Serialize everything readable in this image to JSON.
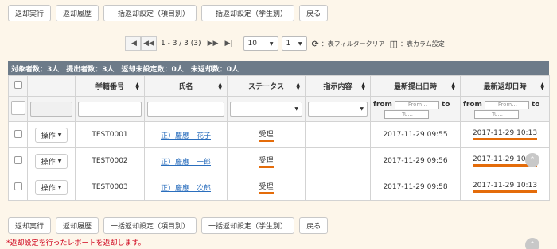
{
  "toolbar": {
    "buttons": [
      "返却実行",
      "返却履歴",
      "一括返却設定（項目別）",
      "一括返却設定（学生別）",
      "戻る"
    ]
  },
  "pager": {
    "range": "1 - 3 / 3 (3)",
    "page_size": "10",
    "page": "1",
    "filter_clear": "：表フィルタークリア",
    "column_settings": "：表カラム設定"
  },
  "summary": "対象者数：3人　提出者数：3人　返却未設定数：0人　未返却数：0人",
  "table": {
    "headers": [
      "学籍番号",
      "氏名",
      "ステータス",
      "指示内容",
      "最新提出日時",
      "最新返却日時"
    ],
    "filter": {
      "from_label": "from",
      "to_label": "to",
      "from_placeholder": "From...",
      "to_placeholder": "To..."
    },
    "op_label": "操作",
    "rows": [
      {
        "id": "TEST0001",
        "name": "正）慶應　花子",
        "status": "受理",
        "submitted": "2017-11-29 09:55",
        "returned": "2017-11-29 10:13"
      },
      {
        "id": "TEST0002",
        "name": "正）慶應　一郎",
        "status": "受理",
        "submitted": "2017-11-29 09:56",
        "returned": "2017-11-29 10:13"
      },
      {
        "id": "TEST0003",
        "name": "正）慶應　次郎",
        "status": "受理",
        "submitted": "2017-11-29 09:58",
        "returned": "2017-11-29 10:13"
      }
    ]
  },
  "note": "*返却設定を行ったレポートを返却します。",
  "colors": {
    "summary_bg": "#6d7b89",
    "highlight": "#e46c0a",
    "link": "#2a6ebd",
    "note": "#d0021b"
  }
}
